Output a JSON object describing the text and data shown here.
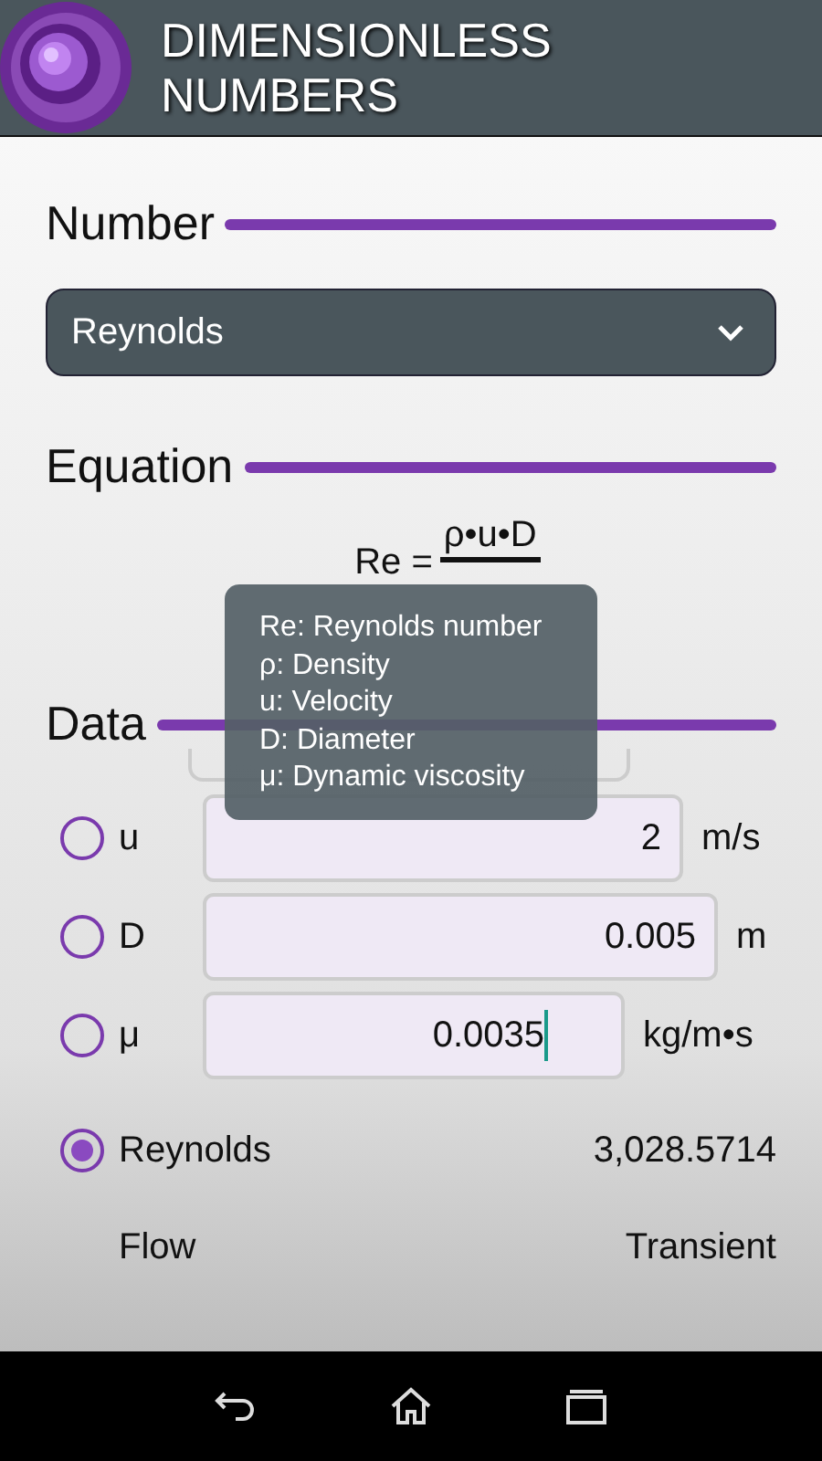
{
  "app": {
    "title": "DIMENSIONLESS NUMBERS"
  },
  "number_section": {
    "heading": "Number",
    "select": {
      "value": "Reynolds"
    }
  },
  "equation_section": {
    "heading": "Equation",
    "lhs": "Re =",
    "numerator": "ρ•u•D"
  },
  "tooltip": {
    "lines": [
      "Re: Reynolds number",
      "ρ: Density",
      "u: Velocity",
      "D: Diameter",
      "μ: Dynamic viscosity"
    ]
  },
  "data_section": {
    "heading": "Data",
    "variables": [
      {
        "symbol": "u",
        "value": "2",
        "unit": "m/s",
        "selected": false,
        "focused": false
      },
      {
        "symbol": "D",
        "value": "0.005",
        "unit": "m",
        "selected": false,
        "focused": false
      },
      {
        "symbol": "μ",
        "value": "0.0035",
        "unit": "kg/m•s",
        "selected": false,
        "focused": true
      }
    ],
    "result": {
      "label": "Reynolds",
      "value": "3,028.5714",
      "selected": true
    },
    "flow": {
      "label": "Flow",
      "value": "Transient"
    }
  }
}
